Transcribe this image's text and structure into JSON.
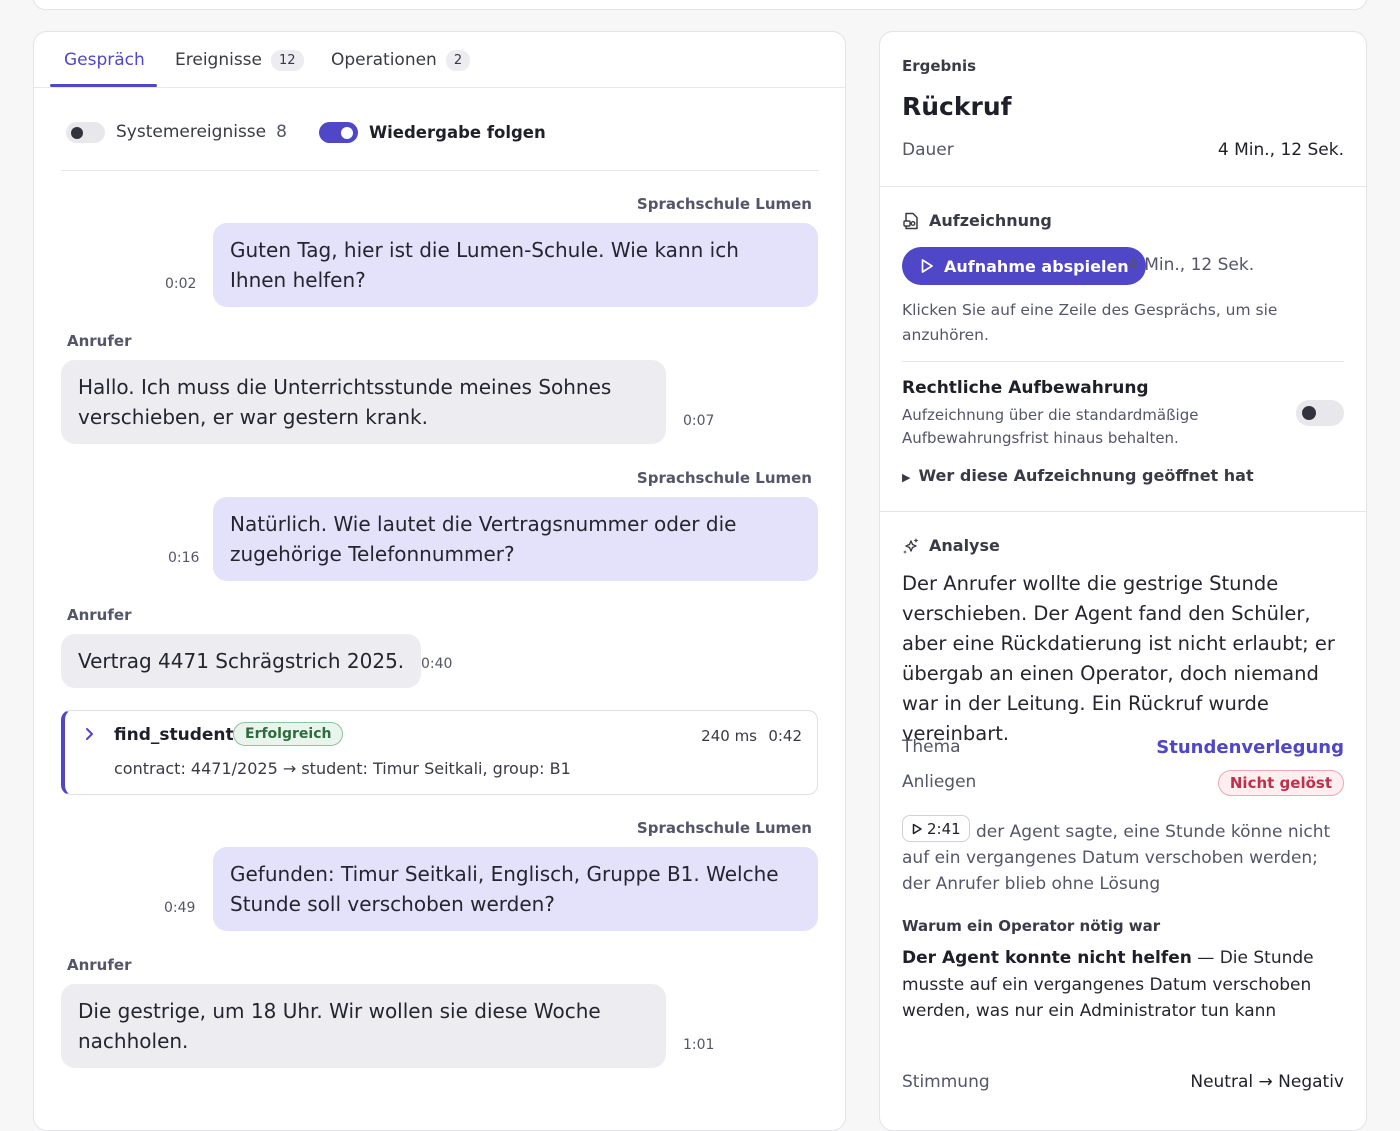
{
  "tabs": [
    {
      "label": "Gespräch",
      "count": ""
    },
    {
      "label": "Ereignisse",
      "count": "12"
    },
    {
      "label": "Operationen",
      "count": "2"
    }
  ],
  "toggles": {
    "system_events_label": "Systemereignisse",
    "system_events_count": "8",
    "follow_playback_label": "Wiedergabe folgen"
  },
  "conversation": [
    {
      "speaker": "Sprachschule Lumen",
      "text": "Guten Tag, hier ist die Lumen-Schule. Wie kann ich Ihnen helfen?",
      "time": "0:02"
    },
    {
      "speaker": "Anrufer",
      "text": "Hallo. Ich muss die Unterrichtsstunde meines Sohnes verschieben, er war gestern krank.",
      "time": "0:07"
    },
    {
      "speaker": "Sprachschule Lumen",
      "text": "Natürlich. Wie lautet die Vertragsnummer oder die zugehörige Telefonnummer?",
      "time": "0:16"
    },
    {
      "speaker": "Anrufer",
      "text": "Vertrag 4471 Schrägstrich 2025.",
      "time": "0:40"
    },
    {
      "speaker": "Sprachschule Lumen",
      "text": "Gefunden: Timur Seitkali, Englisch, Gruppe B1. Welche Stunde soll verschoben werden?",
      "time": "0:49"
    },
    {
      "speaker": "Anrufer",
      "text": "Die gestrige, um 18 Uhr. Wir wollen sie diese Woche nachholen.",
      "time": "1:01"
    }
  ],
  "tool_call": {
    "name": "find_student",
    "status": "Erfolgreich",
    "duration": "240 ms",
    "time": "0:42",
    "detail": "contract: 4471/2025 → student: Timur Seitkali, group: B1"
  },
  "result": {
    "eyebrow": "Ergebnis",
    "title": "Rückruf",
    "duration_label": "Dauer",
    "duration_value": "4 Min., 12 Sek."
  },
  "recording": {
    "heading": "Aufzeichnung",
    "play_label": "Aufnahme abspielen",
    "length": "4 Min., 12 Sek.",
    "hint": "Klicken Sie auf eine Zeile des Gesprächs, um sie anzuhören.",
    "legal_title": "Rechtliche Aufbewahrung",
    "legal_desc": "Aufzeichnung über die standardmäßige Aufbewahrungsfrist hinaus behalten.",
    "opened_by": "Wer diese Aufzeichnung geöffnet hat"
  },
  "analysis": {
    "heading": "Analyse",
    "summary": "Der Anrufer wollte die gestrige Stunde verschieben. Der Agent fand den Schüler, aber eine Rückdatierung ist nicht erlaubt; er übergab an einen Operator, doch niemand war in der Leitung. Ein Rückruf wurde vereinbart.",
    "topic_label": "Thema",
    "topic_value": "Stundenverlegung",
    "issue_label": "Anliegen",
    "issue_status": "Nicht gelöst",
    "timestamp": "2:41",
    "quote": "der Agent sagte, eine Stunde könne nicht auf ein vergangenes Datum verschoben werden; der Anrufer blieb ohne Lösung",
    "why_title": "Warum ein Operator nötig war",
    "why_bold": "Der Agent konnte nicht helfen",
    "why_text": " — Die Stunde musste auf ein vergangenes Datum verschoben werden, was nur ein Administrator tun kann",
    "mood_label": "Stimmung",
    "mood_value": "Neutral → Negativ"
  },
  "colors": {
    "accent": "#4f46c8",
    "agent_bubble": "#e4e1fb",
    "caller_bubble": "#ededf1",
    "success": "#2e6b3f",
    "danger": "#c0304a"
  }
}
